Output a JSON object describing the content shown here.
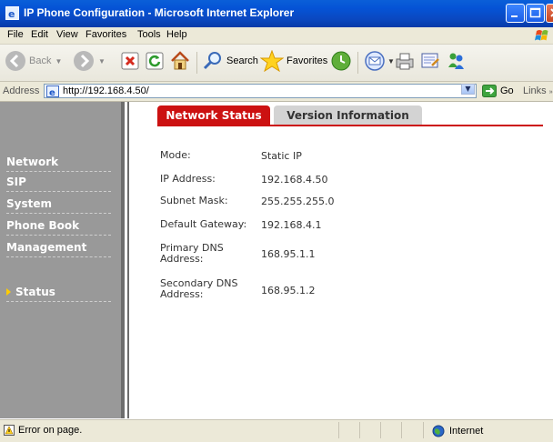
{
  "window": {
    "title": "IP Phone Configuration - Microsoft Internet Explorer"
  },
  "menu": {
    "items": [
      "File",
      "Edit",
      "View",
      "Favorites",
      "Tools",
      "Help"
    ]
  },
  "toolbar": {
    "back_label": "Back",
    "search_label": "Search",
    "favorites_label": "Favorites"
  },
  "address": {
    "label": "Address",
    "url": "http://192.168.4.50/",
    "go_label": "Go",
    "links_label": "Links"
  },
  "sidebar": {
    "items": [
      {
        "label": "Network",
        "active": false
      },
      {
        "label": "SIP",
        "active": false
      },
      {
        "label": "System",
        "active": false
      },
      {
        "label": "Phone Book",
        "active": false
      },
      {
        "label": "Management",
        "active": false
      },
      {
        "label": "Status",
        "active": true
      }
    ]
  },
  "tabs": {
    "active": "Network Status",
    "inactive": "Version Information"
  },
  "network_status": {
    "rows": [
      {
        "label": "Mode:",
        "value": "Static IP"
      },
      {
        "label": "IP Address:",
        "value": "192.168.4.50"
      },
      {
        "label": "Subnet Mask:",
        "value": "255.255.255.0"
      },
      {
        "label": "Default Gateway:",
        "value": "192.168.4.1"
      },
      {
        "label": "Primary DNS Address:",
        "value": "168.95.1.1"
      },
      {
        "label": "Secondary DNS Address:",
        "value": "168.95.1.2"
      }
    ]
  },
  "statusbar": {
    "message": "Error on page.",
    "zone": "Internet"
  },
  "colors": {
    "accent": "#cc1111",
    "sidebar": "#999999",
    "active_arrow": "#ffcc00"
  }
}
